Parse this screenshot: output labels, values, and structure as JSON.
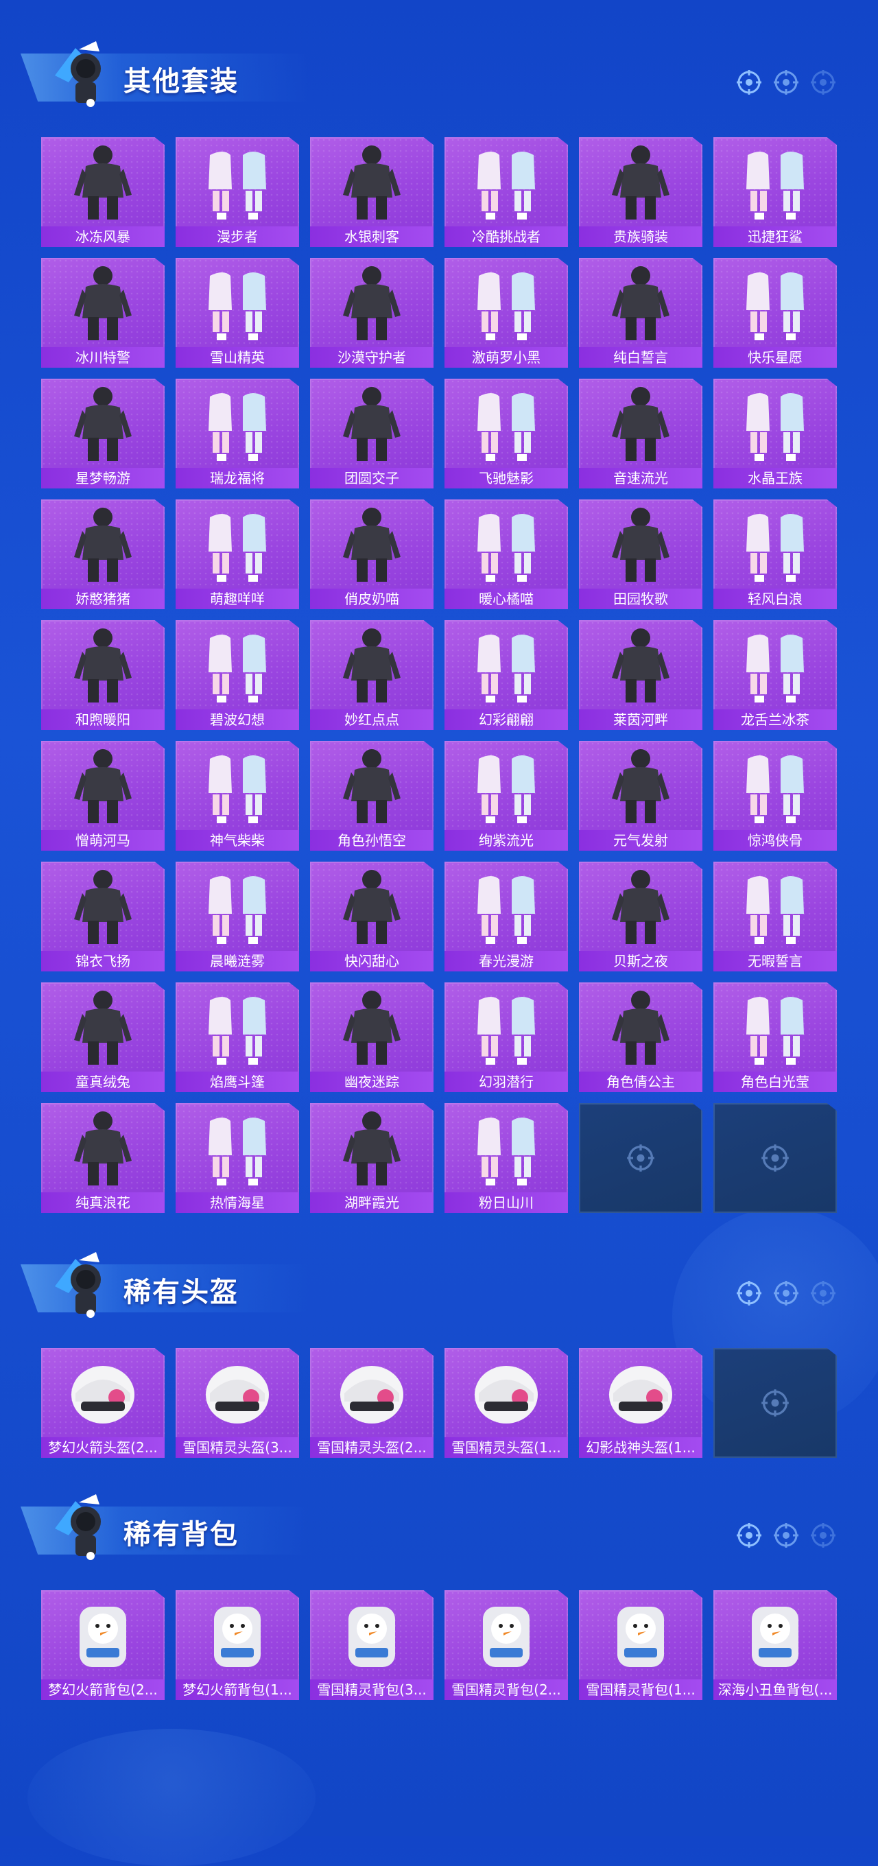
{
  "colors": {
    "background": "#1a53d6",
    "tile": "#9a45e0",
    "tile_label": "#8b2fe0",
    "empty_tile": "#1c3f7a",
    "text": "#ffffff"
  },
  "icons": {
    "header_mascot": "mascot-icon",
    "header_reticle": "reticle-icon",
    "empty_slot": "reticle-icon"
  },
  "sections": [
    {
      "title": "其他套装",
      "items": [
        "冰冻风暴",
        "漫步者",
        "水银刺客",
        "冷酷挑战者",
        "贵族骑装",
        "迅捷狂鲨",
        "冰川特警",
        "雪山精英",
        "沙漠守护者",
        "激萌罗小黑",
        "纯白誓言",
        "快乐星愿",
        "星梦畅游",
        "瑞龙福将",
        "团圆交子",
        "飞驰魅影",
        "音速流光",
        "水晶王族",
        "娇憨猪猪",
        "萌趣咩咩",
        "俏皮奶喵",
        "暖心橘喵",
        "田园牧歌",
        "轻风白浪",
        "和煦暖阳",
        "碧波幻想",
        "妙红点点",
        "幻彩翩翩",
        "莱茵河畔",
        "龙舌兰冰茶",
        "憎萌河马",
        "神气柴柴",
        "角色孙悟空",
        "绚紫流光",
        "元气发射",
        "惊鸿侠骨",
        "锦衣飞扬",
        "晨曦涟雾",
        "快闪甜心",
        "春光漫游",
        "贝斯之夜",
        "无暇誓言",
        "童真绒兔",
        "焰鹰斗篷",
        "幽夜迷踪",
        "幻羽潜行",
        "角色倩公主",
        "角色白光莹",
        "纯真浪花",
        "热情海星",
        "湖畔霞光",
        "粉日山川"
      ],
      "empty_slots": 2
    },
    {
      "title": "稀有头盔",
      "items": [
        "梦幻火箭头盔(2...",
        "雪国精灵头盔(3...",
        "雪国精灵头盔(2...",
        "雪国精灵头盔(1...",
        "幻影战神头盔(1..."
      ],
      "empty_slots": 1
    },
    {
      "title": "稀有背包",
      "items": [
        "梦幻火箭背包(2...",
        "梦幻火箭背包(1...",
        "雪国精灵背包(3...",
        "雪国精灵背包(2...",
        "雪国精灵背包(1...",
        "深海小丑鱼背包(..."
      ],
      "empty_slots": 0
    }
  ]
}
